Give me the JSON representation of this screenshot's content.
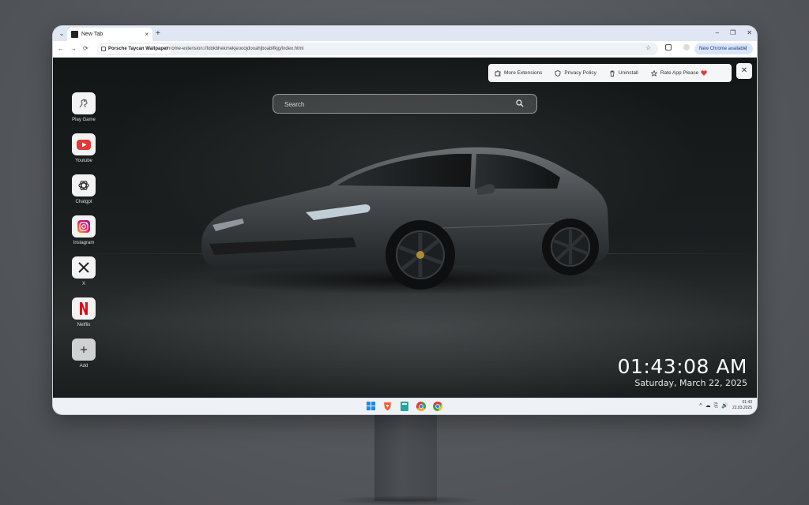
{
  "browser": {
    "tab_title": "New Tab",
    "tab_close": "×",
    "new_tab": "+",
    "window_controls": [
      "⌄",
      "–",
      "❐",
      "✕"
    ],
    "site_chip": "Porsche Taycan Wallpaper",
    "url": "chrome-extension://lobkbhekmekjeooojdooahjboabifkjg/index.html",
    "update_chip": "New Chrome available",
    "nav": [
      "←",
      "→",
      "⟳"
    ]
  },
  "search": {
    "placeholder": "Search"
  },
  "ext_menu": {
    "more_extensions": "More Extensions",
    "privacy_policy": "Privacy Policy",
    "uninstall": "Uninstall",
    "rate_app": "Rate App Please",
    "close": "✕"
  },
  "shortcuts": [
    {
      "label": "Play Game",
      "icon": "game-icon"
    },
    {
      "label": "Youtube",
      "icon": "youtube-icon"
    },
    {
      "label": "Chatgpt",
      "icon": "chatgpt-icon"
    },
    {
      "label": "Instagram",
      "icon": "instagram-icon"
    },
    {
      "label": "X",
      "icon": "x-icon"
    },
    {
      "label": "Netflix",
      "icon": "netflix-icon"
    },
    {
      "label": "Add",
      "icon": "plus-icon"
    }
  ],
  "clock": {
    "time": "01:43:08 AM",
    "date": "Saturday, March 22, 2025"
  },
  "taskbar": {
    "tray_time": "01:43",
    "tray_date": "22.03.2025",
    "tray_icons": [
      "^",
      "☁",
      "⎘",
      "🔊"
    ]
  },
  "colors": {
    "accent_red": "#e53935",
    "update_chip_bg": "#dbe5f8",
    "monitor_bezel": "#e9ebee"
  }
}
